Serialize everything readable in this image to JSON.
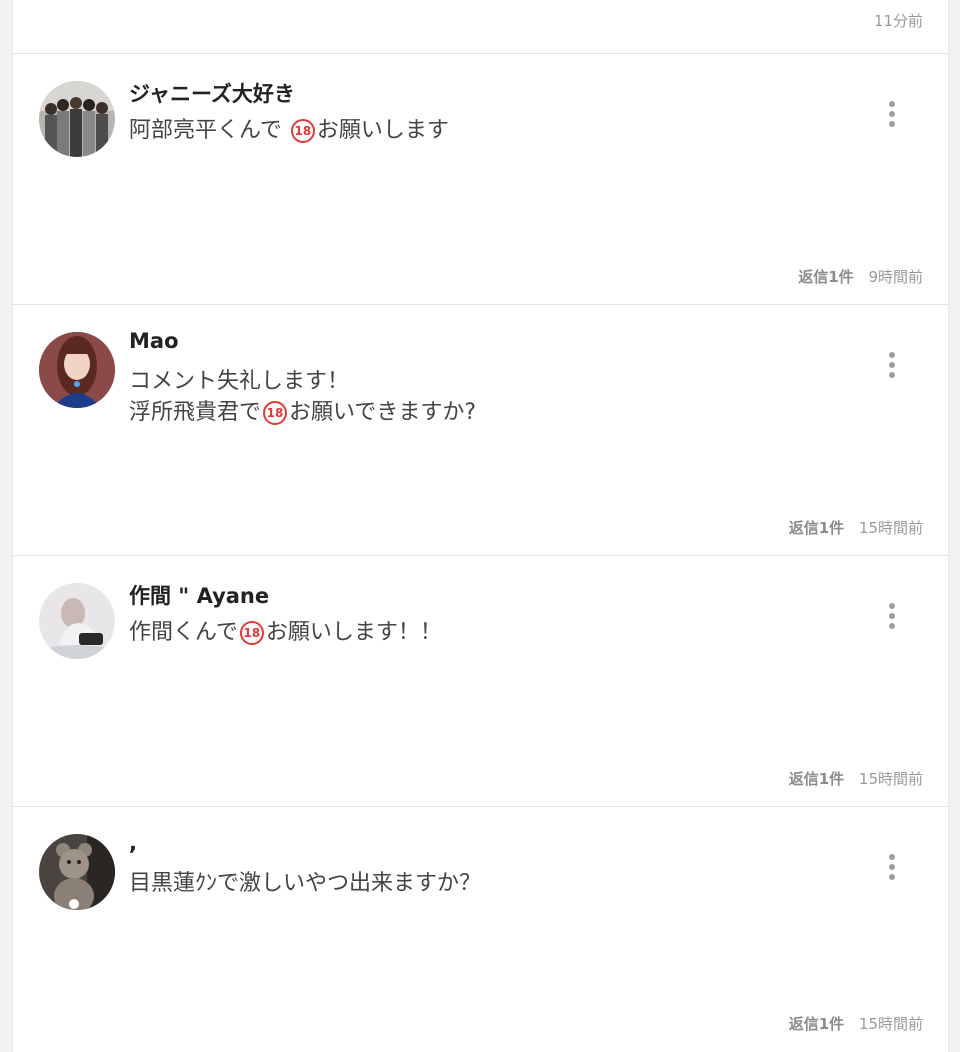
{
  "top_item": {
    "time": "11分前"
  },
  "comments": [
    {
      "username": "ジャニーズ大好き",
      "line1_before": "阿部亮平くんで ",
      "line1_badge": "18",
      "line1_after": "お願いします",
      "reply_label": "返信1件",
      "time": "9時間前",
      "avatar_icon": "group-photo-avatar"
    },
    {
      "username": "Mao",
      "line1": "コメント失礼します！",
      "line2_before": "浮所飛貴君で",
      "line2_badge": "18",
      "line2_after": "お願いできますか?",
      "reply_label": "返信1件",
      "time": "15時間前",
      "avatar_icon": "portrait-avatar"
    },
    {
      "username": "作間 \" Ayane",
      "line1_before": "作間くんで",
      "line1_badge": "18",
      "line1_after": "お願いします！！",
      "reply_label": "返信1件",
      "time": "15時間前",
      "avatar_icon": "photo-avatar"
    },
    {
      "username": ",",
      "line1": "目黒蓮ｸﾝで激しいやつ出来ますか？",
      "reply_label": "返信1件",
      "time": "15時間前",
      "avatar_icon": "teddy-bear-avatar"
    }
  ],
  "colors": {
    "badge": "#e53935",
    "meta_text": "#9a9a9a",
    "divider": "#e3e3e3"
  }
}
